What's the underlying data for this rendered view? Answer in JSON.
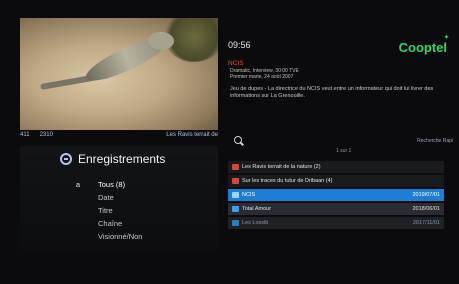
{
  "clock": "09:56",
  "logo": "Cooptel",
  "video": {
    "info": [
      "411",
      "2310",
      "Les Ravis terrait de"
    ]
  },
  "left": {
    "title": "Enregistrements",
    "menu": [
      {
        "bullet": "a",
        "label": "Tous (8)"
      },
      {
        "bullet": "",
        "label": "Date"
      },
      {
        "bullet": "",
        "label": "Titre"
      },
      {
        "bullet": "",
        "label": "Chaîne"
      },
      {
        "bullet": "",
        "label": "Visionné/Non"
      }
    ]
  },
  "program": {
    "title": "NCIS",
    "meta_lines": [
      "Dramatic, Interview, 30:00 TVE",
      "Premier marie, 24 aoüt 2007"
    ],
    "description": "Jeu de dupes - La directrice du NCIS veut entre un informateur qui doit lui livrer des informations sur La Grenouille."
  },
  "search": {
    "hint": "Recherche Rapi"
  },
  "page": "1 sur 1",
  "recordings": [
    {
      "kind": "folder",
      "title": "Les Ravis terrait de la nature (2)",
      "date": ""
    },
    {
      "kind": "folder",
      "title": "Sur les traces du tutur de Dribaan (4)",
      "date": ""
    },
    {
      "kind": "sel",
      "title": "NCIS",
      "date": "2019/07/01"
    },
    {
      "kind": "item",
      "title": "Total Amour",
      "date": "2018/06/01"
    },
    {
      "kind": "dim",
      "title": "Les Lossib",
      "date": "2017/11/01"
    }
  ]
}
